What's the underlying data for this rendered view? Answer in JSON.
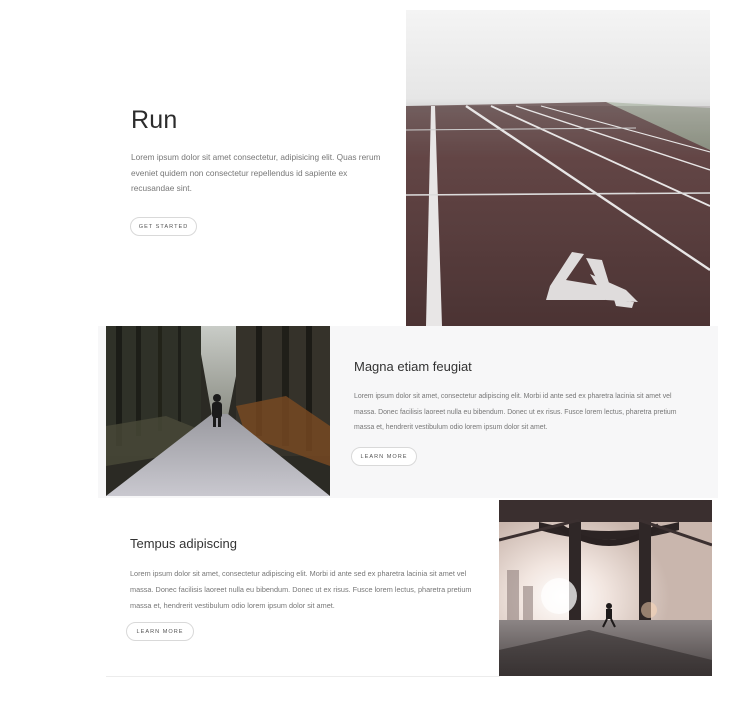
{
  "sections": [
    {
      "title": "Run",
      "description": "Lorem ipsum dolor sit amet consectetur, adipisicing elit. Quas rerum eveniet quidem non consectetur repellendus id sapiente ex recusandae sint.",
      "button_label": "Get Started",
      "image": "running-track-photo"
    },
    {
      "title": "Magna etiam feugiat",
      "description": "Lorem ipsum dolor sit amet, consectetur adipiscing elit. Morbi id ante sed ex pharetra lacinia sit amet vel massa. Donec facilisis laoreet nulla eu bibendum. Donec ut ex risus. Fusce lorem lectus, pharetra pretium massa et, hendrerit vestibulum odio lorem ipsum dolor sit amet.",
      "button_label": "Learn More",
      "image": "forest-path-runner-photo"
    },
    {
      "title": "Tempus adipiscing",
      "description": "Lorem ipsum dolor sit amet, consectetur adipiscing elit. Morbi id ante sed ex pharetra lacinia sit amet vel massa. Donec facilisis laoreet nulla eu bibendum. Donec ut ex risus. Fusce lorem lectus, pharetra pretium massa et, hendrerit vestibulum odio lorem ipsum dolor sit amet.",
      "button_label": "Learn More",
      "image": "bridge-runner-photo"
    }
  ],
  "colors": {
    "section_alt_bg": "#f7f7f8",
    "track": "#5a3a3a",
    "button_border": "#d9d9d9"
  }
}
